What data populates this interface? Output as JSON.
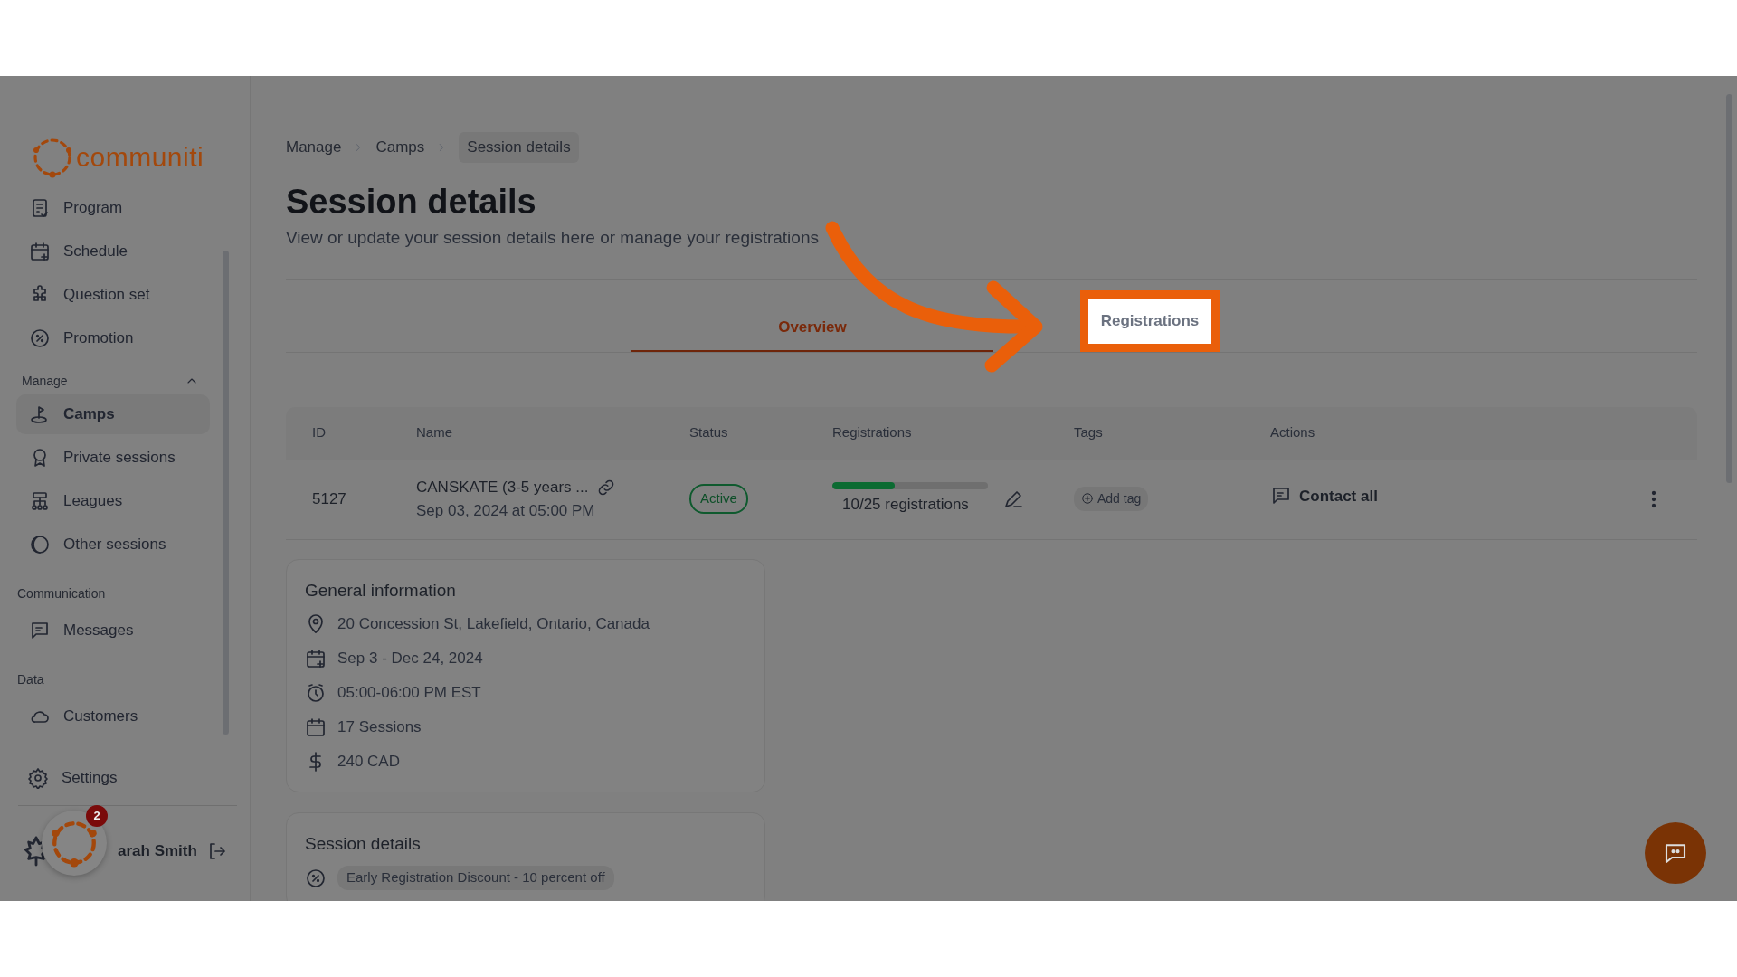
{
  "sidebar": {
    "logo_text": "communiti",
    "items": [
      {
        "kind": "item",
        "label": "Program",
        "selected": false
      },
      {
        "kind": "item",
        "label": "Schedule",
        "selected": false
      },
      {
        "kind": "item",
        "label": "Question set",
        "selected": false
      },
      {
        "kind": "item",
        "label": "Promotion",
        "selected": false
      },
      {
        "kind": "heading",
        "label": "Manage",
        "expanded": true
      },
      {
        "kind": "item",
        "label": "Camps",
        "selected": true
      },
      {
        "kind": "item",
        "label": "Private sessions",
        "selected": false
      },
      {
        "kind": "item",
        "label": "Leagues",
        "selected": false
      },
      {
        "kind": "item",
        "label": "Other sessions",
        "selected": false
      },
      {
        "kind": "heading",
        "label": "Communication"
      },
      {
        "kind": "item",
        "label": "Messages",
        "selected": false
      },
      {
        "kind": "heading",
        "label": "Data"
      },
      {
        "kind": "item",
        "label": "Customers",
        "selected": false
      }
    ],
    "settings": "Settings",
    "user_name": "arah Smith",
    "notification_count": "2"
  },
  "breadcrumb": [
    {
      "label": "Manage",
      "current": false
    },
    {
      "label": "Camps",
      "current": false
    },
    {
      "label": "Session details",
      "current": true
    }
  ],
  "title": "Session details",
  "subtitle": "View or update your session details here or manage your registrations",
  "tabs": [
    {
      "label": "Overview",
      "selected": true,
      "highlighted": false
    },
    {
      "label": "Registrations",
      "selected": false,
      "highlighted": true
    }
  ],
  "table": {
    "columns": [
      "ID",
      "Name",
      "Status",
      "Registrations",
      "Tags",
      "Actions"
    ],
    "rows": [
      {
        "id": "5127",
        "name": "CANSKATE (3-5 years ...",
        "date": "Sep 03, 2024 at 05:00 PM",
        "status": "Active",
        "level": 0.4,
        "registrations": "10/25 registrations",
        "tag_button": "Add tag",
        "action": "Contact all"
      }
    ]
  },
  "general_info": {
    "title": "General information",
    "items": [
      "20 Concession St, Lakefield, Ontario, Canada",
      "Sep 3 - Dec 24, 2024",
      "05:00-06:00 PM EST",
      "17 Sessions",
      "240 CAD"
    ]
  },
  "session_details": {
    "title": "Session details",
    "items": [
      "Early Registration Discount - 10 percent off"
    ]
  }
}
